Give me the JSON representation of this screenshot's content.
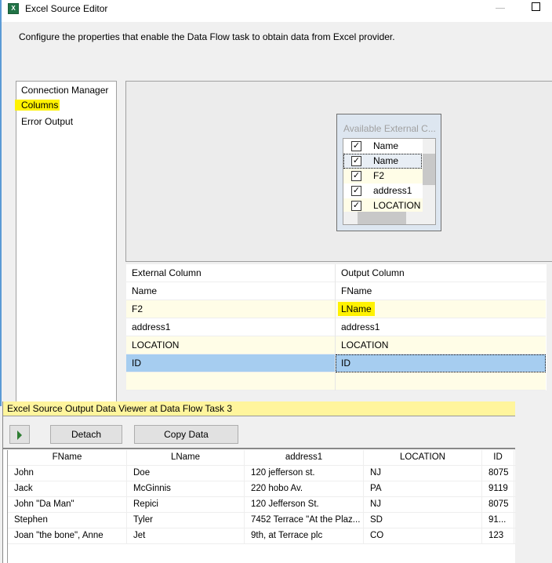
{
  "window": {
    "title": "Excel Source Editor",
    "description": "Configure the properties that enable the Data Flow task to obtain data from Excel provider."
  },
  "nav": {
    "items": [
      {
        "label": "Connection Manager"
      },
      {
        "label": "Columns"
      },
      {
        "label": "Error Output"
      }
    ],
    "selected": "Columns"
  },
  "available": {
    "title": "Available External C...",
    "items": [
      {
        "label": "Name",
        "checked": true
      },
      {
        "label": "Name",
        "checked": true
      },
      {
        "label": "F2",
        "checked": true
      },
      {
        "label": "address1",
        "checked": true
      },
      {
        "label": "LOCATION",
        "checked": true
      }
    ]
  },
  "mapping": {
    "headers": [
      "External Column",
      "Output Column"
    ],
    "rows": [
      [
        "Name",
        "FName"
      ],
      [
        "F2",
        "LName"
      ],
      [
        "address1",
        "address1"
      ],
      [
        "LOCATION",
        "LOCATION"
      ],
      [
        "ID",
        "ID"
      ],
      [
        "",
        ""
      ]
    ]
  },
  "viewer": {
    "title": "Excel Source Output Data Viewer at Data Flow Task 3",
    "detach_label": "Detach",
    "copy_label": "Copy Data",
    "headers": [
      "FName",
      "LName",
      "address1",
      "LOCATION",
      "ID"
    ],
    "rows": [
      [
        "John",
        "Doe",
        "120 jefferson st.",
        "NJ",
        "8075"
      ],
      [
        "Jack",
        "McGinnis",
        "220 hobo Av.",
        "PA",
        "9119"
      ],
      [
        "John \"Da Man\"",
        "Repici",
        "120 Jefferson St.",
        "NJ",
        "8075"
      ],
      [
        "Stephen",
        "Tyler",
        "7452 Terrace \"At the Plaz...",
        "SD",
        "91..."
      ],
      [
        "Joan \"the bone\", Anne",
        "Jet",
        "9th, at Terrace plc",
        "CO",
        "123"
      ]
    ]
  },
  "colors": {
    "highlight": "#fff200",
    "selected_row": "#a6cdf0",
    "alt_row": "#fffde7"
  }
}
